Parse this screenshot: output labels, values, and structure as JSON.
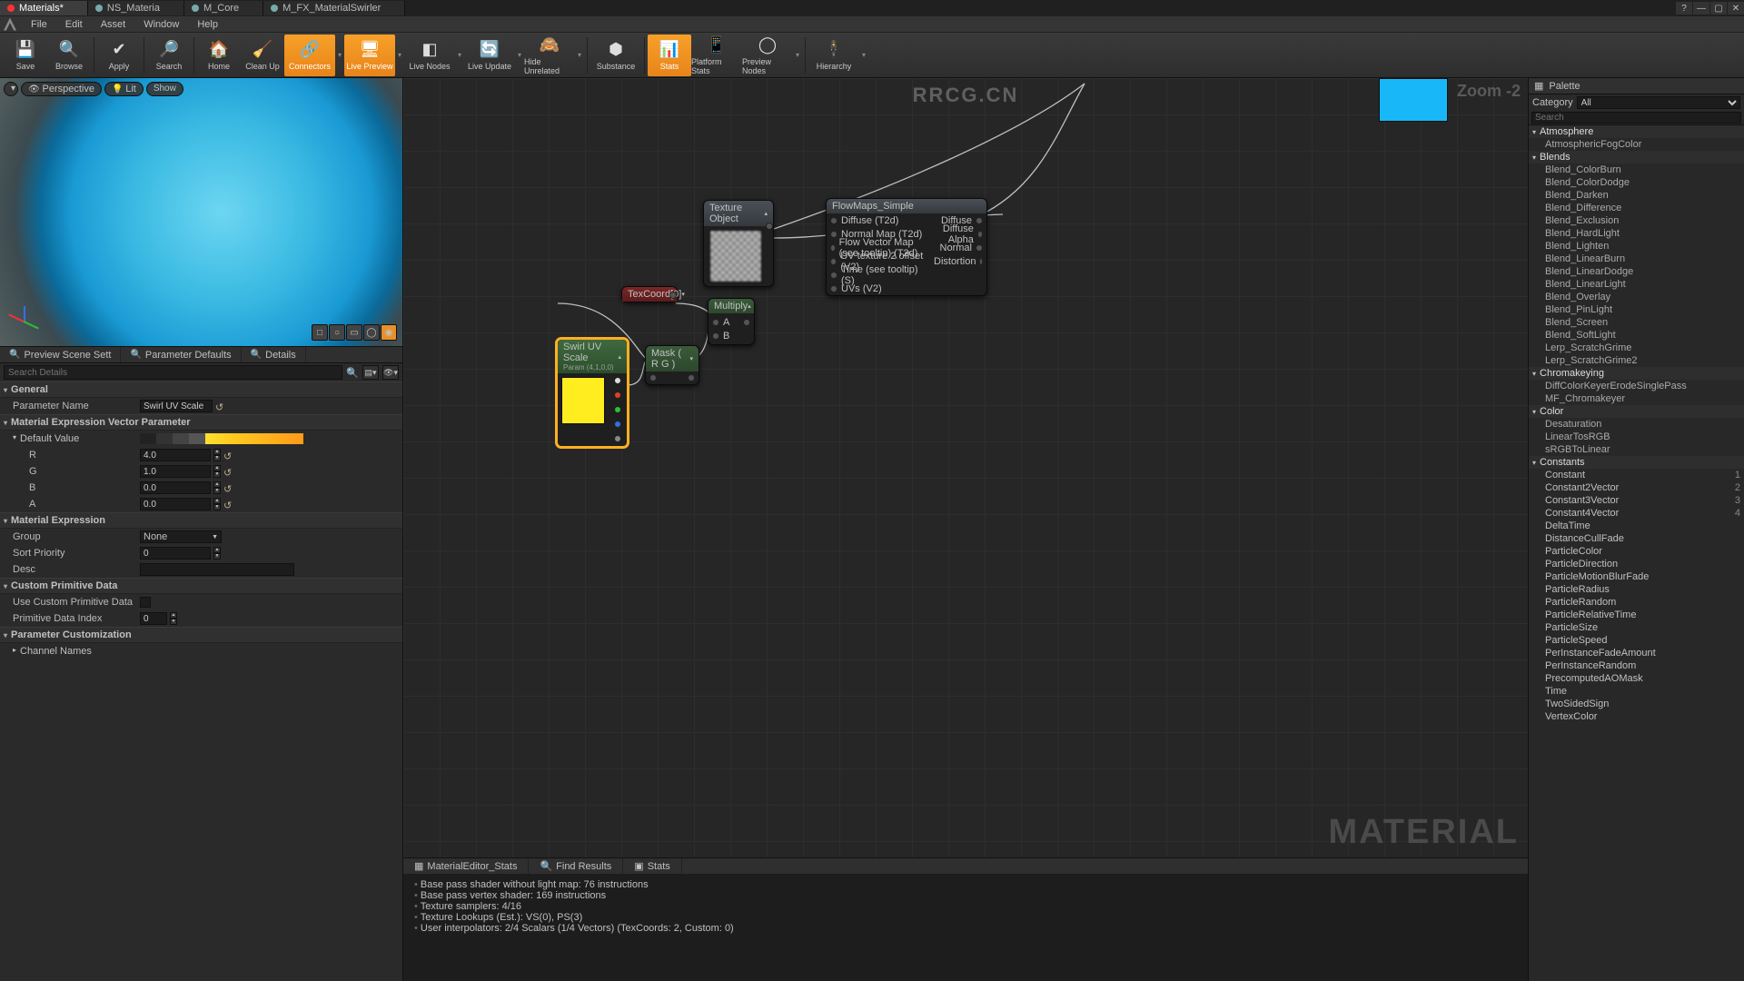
{
  "watermark": "RRCG.CN",
  "tabs": [
    {
      "label": "Materials*",
      "active": true
    },
    {
      "label": "NS_Materia",
      "active": false
    },
    {
      "label": "M_Core",
      "active": false
    },
    {
      "label": "M_FX_MaterialSwirler",
      "active": false
    }
  ],
  "menu": [
    "File",
    "Edit",
    "Asset",
    "Window",
    "Help"
  ],
  "toolbar": [
    {
      "label": "Save",
      "icon": "💾"
    },
    {
      "label": "Browse",
      "icon": "🔍"
    },
    {
      "sep": true
    },
    {
      "label": "Apply",
      "icon": "✔"
    },
    {
      "sep": true
    },
    {
      "label": "Search",
      "icon": "🔎"
    },
    {
      "sep": true
    },
    {
      "label": "Home",
      "icon": "🏠"
    },
    {
      "label": "Clean Up",
      "icon": "🧹"
    },
    {
      "label": "Connectors",
      "icon": "🔗",
      "active": true,
      "dd": true
    },
    {
      "label": "Live Preview",
      "icon": "🖥",
      "active": true,
      "dd": true
    },
    {
      "label": "Live Nodes",
      "icon": "◧",
      "dd": true
    },
    {
      "label": "Live Update",
      "icon": "🔄",
      "dd": true
    },
    {
      "label": "Hide Unrelated",
      "icon": "🙈",
      "dd": true
    },
    {
      "sep": true
    },
    {
      "label": "Substance",
      "icon": "⬢"
    },
    {
      "sep": true
    },
    {
      "label": "Stats",
      "icon": "📊",
      "active": true
    },
    {
      "label": "Platform Stats",
      "icon": "📱"
    },
    {
      "label": "Preview Nodes",
      "icon": "◯",
      "dd": true
    },
    {
      "sep": true
    },
    {
      "label": "Hierarchy",
      "icon": "🕴",
      "dd": true
    }
  ],
  "viewport": {
    "btns": [
      "▾",
      "Perspective",
      "Lit",
      "Show"
    ],
    "shapes": [
      "□",
      "○",
      "▭",
      "◯",
      "◉"
    ]
  },
  "detailTabs": [
    "Preview Scene Sett",
    "Parameter Defaults",
    "Details"
  ],
  "search": {
    "placeholder": "Search Details"
  },
  "details": {
    "general": {
      "header": "General",
      "paramName": {
        "label": "Parameter Name",
        "value": "Swirl UV Scale"
      }
    },
    "mevp": {
      "header": "Material Expression Vector Parameter",
      "defaultLabel": "Default Value",
      "rows": [
        {
          "label": "R",
          "value": "4.0"
        },
        {
          "label": "G",
          "value": "1.0"
        },
        {
          "label": "B",
          "value": "0.0"
        },
        {
          "label": "A",
          "value": "0.0"
        }
      ]
    },
    "me": {
      "header": "Material Expression",
      "group": {
        "label": "Group",
        "value": "None"
      },
      "sort": {
        "label": "Sort Priority",
        "value": "0"
      },
      "desc": {
        "label": "Desc",
        "value": ""
      }
    },
    "cpd": {
      "header": "Custom Primitive Data",
      "use": {
        "label": "Use Custom Primitive Data"
      },
      "idx": {
        "label": "Primitive Data Index",
        "value": "0"
      }
    },
    "pc": {
      "header": "Parameter Customization",
      "channel": "Channel Names"
    }
  },
  "graph": {
    "zoom": "Zoom  -2",
    "wm": "MATERIAL",
    "texObj": {
      "title": "Texture Object"
    },
    "flow": {
      "title": "FlowMaps_Simple",
      "inputs": [
        "Diffuse (T2d)",
        "Normal Map (T2d)",
        "Flow Vector Map (see tooltip) (T2d)",
        "UV texture 2 offset (V2)",
        "Time (see tooltip) (S)",
        "UVs (V2)"
      ],
      "outputs": [
        "Diffuse",
        "Diffuse Alpha",
        "Normal",
        "Distortion"
      ]
    },
    "texcoord": {
      "title": "TexCoord[0]"
    },
    "multiply": {
      "title": "Multiply",
      "pins": [
        "",
        "A",
        "B"
      ]
    },
    "mask": {
      "title": "Mask ( R G )"
    },
    "swirl": {
      "title": "Swirl UV Scale",
      "sub": "Param (4,1,0,0)"
    }
  },
  "statsTabs": [
    "MaterialEditor_Stats",
    "Find Results",
    "Stats"
  ],
  "stats": [
    "Base pass shader without light map: 76 instructions",
    "Base pass vertex shader: 169 instructions",
    "Texture samplers: 4/16",
    "Texture Lookups (Est.): VS(0), PS(3)",
    "User interpolators: 2/4 Scalars (1/4 Vectors) (TexCoords: 2, Custom: 0)"
  ],
  "palette": {
    "title": "Palette",
    "category": {
      "label": "Category",
      "value": "All"
    },
    "searchPlaceholder": "Search",
    "groups": [
      {
        "name": "Atmosphere",
        "items": [
          "AtmosphericFogColor"
        ]
      },
      {
        "name": "Blends",
        "items": [
          "Blend_ColorBurn",
          "Blend_ColorDodge",
          "Blend_Darken",
          "Blend_Difference",
          "Blend_Exclusion",
          "Blend_HardLight",
          "Blend_Lighten",
          "Blend_LinearBurn",
          "Blend_LinearDodge",
          "Blend_LinearLight",
          "Blend_Overlay",
          "Blend_PinLight",
          "Blend_Screen",
          "Blend_SoftLight",
          "Lerp_ScratchGrime",
          "Lerp_ScratchGrime2"
        ]
      },
      {
        "name": "Chromakeying",
        "items": [
          "DiffColorKeyerErodeSinglePass",
          "MF_Chromakeyer"
        ]
      },
      {
        "name": "Color",
        "items": [
          "Desaturation",
          "LinearTosRGB",
          "sRGBToLinear"
        ]
      },
      {
        "name": "Constants",
        "items": [
          {
            "n": "Constant",
            "h": "1"
          },
          {
            "n": "Constant2Vector",
            "h": "2"
          },
          {
            "n": "Constant3Vector",
            "h": "3"
          },
          {
            "n": "Constant4Vector",
            "h": "4"
          },
          {
            "n": "DeltaTime"
          },
          {
            "n": "DistanceCullFade"
          },
          {
            "n": "ParticleColor"
          },
          {
            "n": "ParticleDirection"
          },
          {
            "n": "ParticleMotionBlurFade"
          },
          {
            "n": "ParticleRadius"
          },
          {
            "n": "ParticleRandom"
          },
          {
            "n": "ParticleRelativeTime"
          },
          {
            "n": "ParticleSize"
          },
          {
            "n": "ParticleSpeed"
          },
          {
            "n": "PerInstanceFadeAmount"
          },
          {
            "n": "PerInstanceRandom"
          },
          {
            "n": "PrecomputedAOMask"
          },
          {
            "n": "Time"
          },
          {
            "n": "TwoSidedSign"
          },
          {
            "n": "VertexColor"
          }
        ]
      }
    ]
  }
}
